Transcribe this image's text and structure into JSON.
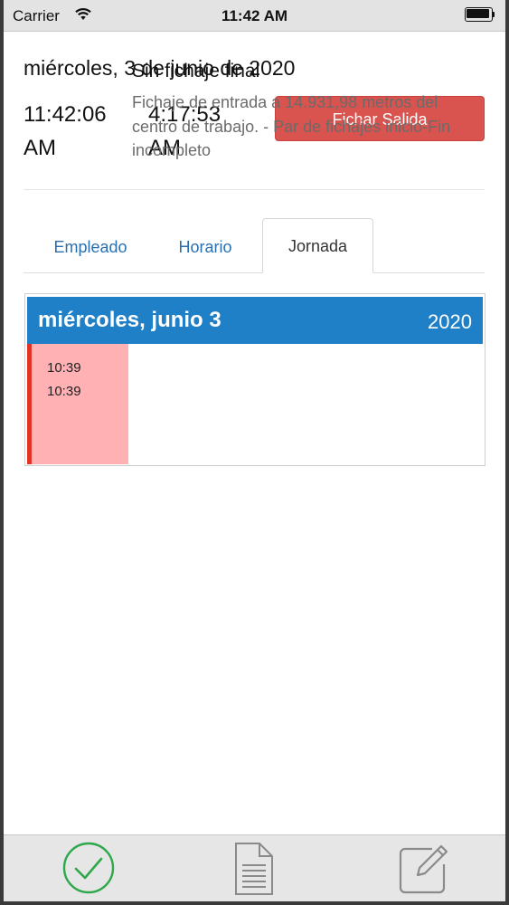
{
  "status": {
    "carrier": "Carrier",
    "time": "11:42 AM"
  },
  "header": {
    "date": "miércoles, 3 de junio de 2020",
    "time_start": "11:42:06 AM",
    "time_end": "4:17:53 AM",
    "action_label": "Fichar Salida"
  },
  "tabs": [
    {
      "label": "Empleado"
    },
    {
      "label": "Horario"
    },
    {
      "label": "Jornada"
    }
  ],
  "active_tab": "Jornada",
  "day": {
    "title": "miércoles, junio 3",
    "year": "2020",
    "entry": {
      "time_in": "10:39",
      "time_out": "10:39",
      "title": "Sin fichaje final",
      "description": "Fichaje de entrada a 14.931,98 metros del centro de trabajo. - Par de fichajes inicio-Fin incompleto"
    }
  },
  "tabbar": {
    "icons": [
      "check-circle-icon",
      "document-icon",
      "edit-icon"
    ]
  },
  "colors": {
    "accent": "#1f80c8",
    "danger": "#d9534f",
    "entry_bg": "#ffb1b4",
    "check": "#2ea84a"
  }
}
